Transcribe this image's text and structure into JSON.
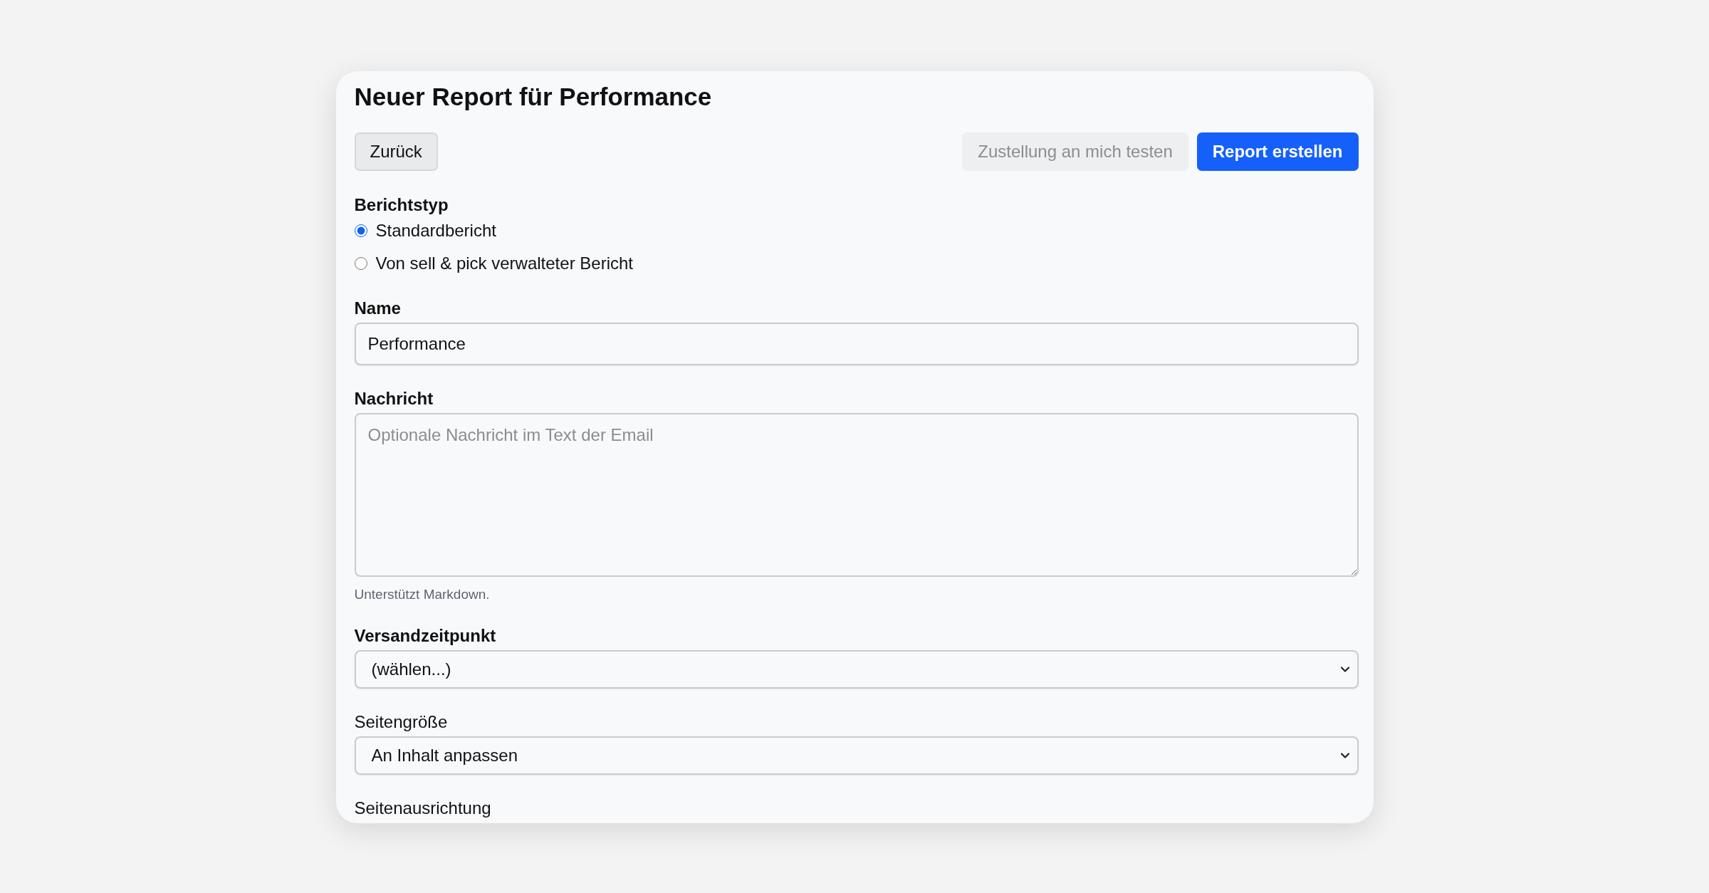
{
  "title": "Neuer Report für Performance",
  "left_buttons": [
    {
      "label": "Zurück",
      "kind": "secondary",
      "disabled": false
    }
  ],
  "right_buttons": [
    {
      "label": "Zustellung an mich testen",
      "kind": "secondary",
      "disabled": true
    },
    {
      "label": "Report erstellen",
      "kind": "primary",
      "disabled": false
    }
  ],
  "fields": [
    {
      "kind": "radio",
      "label": "Berichtstyp",
      "label_bold": true,
      "options": [
        {
          "label": "Standardbericht",
          "selected": true
        },
        {
          "label": "Von sell & pick verwalteter Bericht",
          "selected": false
        }
      ]
    },
    {
      "kind": "text",
      "label": "Name",
      "label_bold": true,
      "value": "Performance"
    },
    {
      "kind": "textarea",
      "label": "Nachricht",
      "label_bold": true,
      "placeholder": "Optionale Nachricht im Text der Email",
      "hint": "Unterstützt Markdown."
    },
    {
      "kind": "select",
      "label": "Versandzeitpunkt",
      "label_bold": true,
      "value": "(wählen...)"
    },
    {
      "kind": "select",
      "label": "Seitengröße",
      "label_bold": false,
      "value": "An Inhalt anpassen"
    },
    {
      "kind": "label",
      "label": "Seitenausrichtung",
      "label_bold": false
    }
  ]
}
